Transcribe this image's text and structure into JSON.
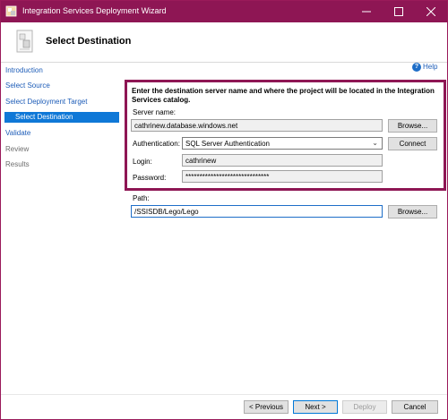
{
  "window": {
    "title": "Integration Services Deployment Wizard"
  },
  "header": {
    "title": "Select Destination"
  },
  "nav": {
    "items": [
      {
        "label": "Introduction"
      },
      {
        "label": "Select Source"
      },
      {
        "label": "Select Deployment Target"
      },
      {
        "label": "Select Destination"
      },
      {
        "label": "Validate"
      },
      {
        "label": "Review"
      },
      {
        "label": "Results"
      }
    ]
  },
  "help": {
    "label": "Help"
  },
  "form": {
    "instructions": "Enter the destination server name and where the project will be located in the Integration Services catalog.",
    "server_label": "Server name:",
    "server_value": "cathrinew.database.windows.net",
    "browse_label": "Browse...",
    "auth_label": "Authentication:",
    "auth_value": "SQL Server Authentication",
    "connect_label": "Connect",
    "login_label": "Login:",
    "login_value": "cathrinew",
    "password_label": "Password:",
    "password_value": "******************************",
    "path_label": "Path:",
    "path_value": "/SSISDB/Lego/Lego",
    "path_browse_label": "Browse..."
  },
  "footer": {
    "previous_label": "< Previous",
    "next_label": "Next >",
    "deploy_label": "Deploy",
    "cancel_label": "Cancel"
  },
  "colors": {
    "accent": "#8e1654",
    "link": "#1e5db8",
    "selection": "#0f78d7"
  }
}
